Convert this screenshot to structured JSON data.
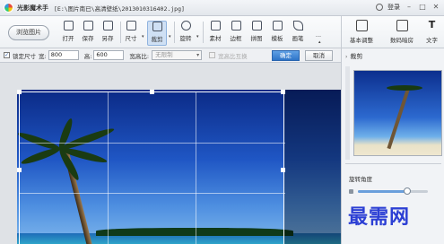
{
  "titlebar": {
    "app_name": "光影魔术手",
    "file_path": "[E:\\图片南已\\高清壁纸\\2013010316402.jpg]",
    "login": "登录",
    "min": "–",
    "max": "□",
    "close": "✕"
  },
  "toolbar": {
    "browse": "浏览图片",
    "tools": [
      {
        "label": "打开",
        "icon": "open-icon"
      },
      {
        "label": "保存",
        "icon": "save-icon"
      },
      {
        "label": "另存",
        "icon": "save-as-icon"
      },
      {
        "label": "尺寸",
        "icon": "resize-icon"
      },
      {
        "label": "裁剪",
        "icon": "crop-icon",
        "active": true
      },
      {
        "label": "旋转",
        "icon": "rotate-icon"
      },
      {
        "label": "素材",
        "icon": "material-icon"
      },
      {
        "label": "边框",
        "icon": "border-icon"
      },
      {
        "label": "拼图",
        "icon": "collage-icon"
      },
      {
        "label": "模板",
        "icon": "template-icon"
      },
      {
        "label": "画笔",
        "icon": "brush-icon"
      },
      {
        "label": "···",
        "icon": "more-icon"
      }
    ],
    "big_tools": [
      {
        "label": "基本调整",
        "icon": "basic-adjust-icon"
      },
      {
        "label": "数码暗房",
        "icon": "darkroom-icon"
      },
      {
        "label": "文字",
        "icon": "text-icon"
      }
    ]
  },
  "crop_options": {
    "lock_size_label": "锁定尺寸",
    "width_label": "宽:",
    "width_value": "800",
    "height_label": "高:",
    "height_value": "600",
    "ratio_label": "宽高比:",
    "ratio_value": "无限制",
    "swap_label": "宽高比互换",
    "confirm": "确定",
    "cancel": "取消"
  },
  "right_panel": {
    "section_title": "裁剪",
    "rotate_title": "旋转角度",
    "rotate_fraction": 0.7
  },
  "watermark": "最需网"
}
